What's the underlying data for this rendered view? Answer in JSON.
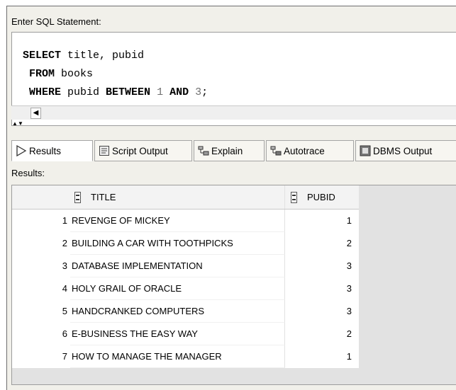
{
  "editor": {
    "label": "Enter SQL Statement:",
    "lines": [
      [
        {
          "t": "SELECT",
          "k": "kw"
        },
        {
          "t": " title, pubid"
        }
      ],
      [
        {
          "t": " "
        },
        {
          "t": "FROM",
          "k": "kw"
        },
        {
          "t": " books"
        }
      ],
      [
        {
          "t": " "
        },
        {
          "t": "WHERE",
          "k": "kw"
        },
        {
          "t": " pubid "
        },
        {
          "t": "BETWEEN",
          "k": "kw"
        },
        {
          "t": " "
        },
        {
          "t": "1",
          "k": "num"
        },
        {
          "t": " "
        },
        {
          "t": "AND",
          "k": "kw"
        },
        {
          "t": " "
        },
        {
          "t": "3",
          "k": "num"
        },
        {
          "t": ";"
        }
      ]
    ]
  },
  "tabs": [
    {
      "label": "Results",
      "icon": "play-arrow-icon",
      "active": true
    },
    {
      "label": "Script Output",
      "icon": "script-icon",
      "active": false
    },
    {
      "label": "Explain",
      "icon": "explain-icon",
      "active": false
    },
    {
      "label": "Autotrace",
      "icon": "autotrace-icon",
      "active": false
    },
    {
      "label": "DBMS Output",
      "icon": "dbms-icon",
      "active": false
    }
  ],
  "results": {
    "label": "Results:",
    "columns": [
      "TITLE",
      "PUBID"
    ],
    "rows": [
      {
        "n": "1",
        "title": "REVENGE OF MICKEY",
        "pubid": "1"
      },
      {
        "n": "2",
        "title": "BUILDING A CAR WITH TOOTHPICKS",
        "pubid": "2"
      },
      {
        "n": "3",
        "title": "DATABASE IMPLEMENTATION",
        "pubid": "3"
      },
      {
        "n": "4",
        "title": "HOLY GRAIL OF ORACLE",
        "pubid": "3"
      },
      {
        "n": "5",
        "title": "HANDCRANKED COMPUTERS",
        "pubid": "3"
      },
      {
        "n": "6",
        "title": "E-BUSINESS THE EASY WAY",
        "pubid": "2"
      },
      {
        "n": "7",
        "title": "HOW TO MANAGE THE MANAGER",
        "pubid": "1"
      }
    ]
  }
}
